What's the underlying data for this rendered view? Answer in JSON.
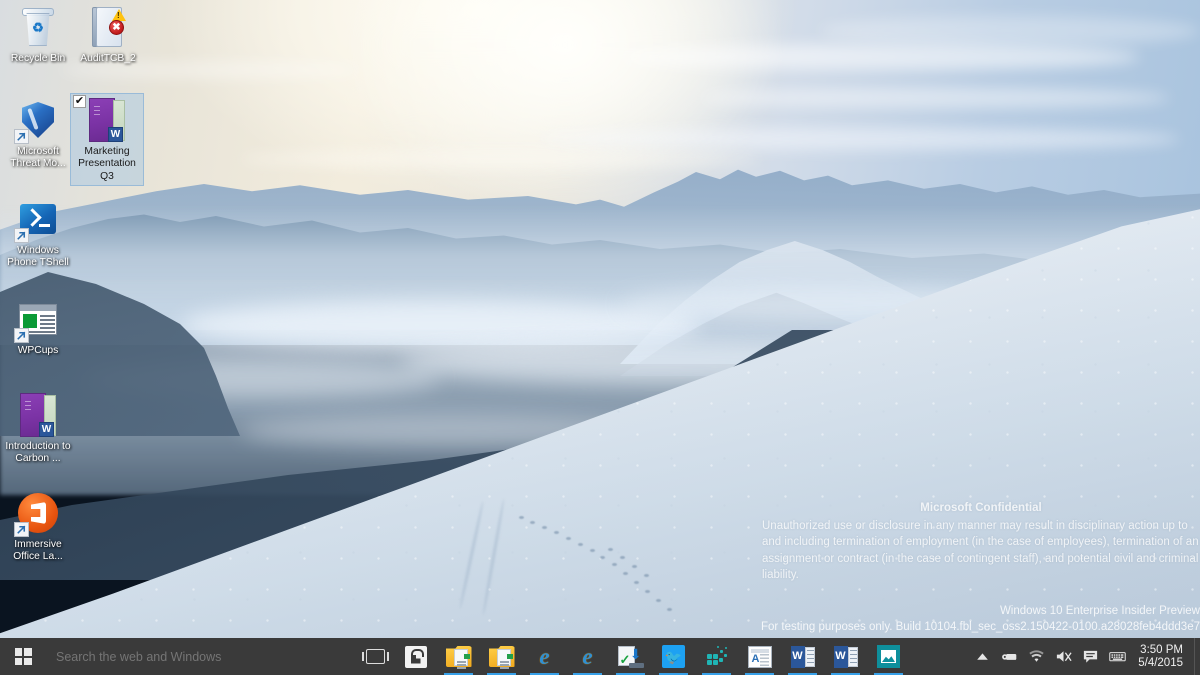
{
  "desktop": {
    "icons": [
      {
        "label": "Recycle Bin",
        "glyph": "recycle-bin-icon",
        "selected": false,
        "shortcut": false
      },
      {
        "label": "AuditTCB_2",
        "glyph": "document-error-icon",
        "selected": false,
        "shortcut": false
      },
      {
        "label": "Microsoft Threat Mo...",
        "glyph": "shield-icon",
        "selected": false,
        "shortcut": true
      },
      {
        "label": "Marketing Presentation Q3",
        "glyph": "word-document-icon",
        "selected": true,
        "shortcut": false
      },
      {
        "label": "Windows Phone TShell",
        "glyph": "powershell-icon",
        "selected": false,
        "shortcut": true
      },
      {
        "label": "WPCups",
        "glyph": "window-app-icon",
        "selected": false,
        "shortcut": true
      },
      {
        "label": "Introduction to Carbon ...",
        "glyph": "word-document-icon",
        "selected": false,
        "shortcut": false
      },
      {
        "label": "Immersive Office La...",
        "glyph": "office-orb-icon",
        "selected": false,
        "shortcut": true
      }
    ]
  },
  "watermark": {
    "confidential_title": "Microsoft Confidential",
    "confidential_body": "Unauthorized use or disclosure in any manner may result in disciplinary action up to and including termination of employment (in the case of employees), termination of an assignment or contract (in the case of contingent staff), and potential civil and criminal liability.",
    "build_line1": "Windows 10 Enterprise Insider Preview",
    "build_line2": "For testing purposes only. Build 10104.fbl_sec_oss2.150422-0100.a28028feb4ddd3e7"
  },
  "taskbar": {
    "start_label": "Start",
    "search_placeholder": "Search the web and Windows",
    "search_value": "",
    "task_view_label": "Task View",
    "pinned": [
      {
        "name": "store",
        "label": "Store",
        "running": false
      },
      {
        "name": "file-explorer",
        "label": "File Explorer",
        "running": true
      },
      {
        "name": "file-explorer-2",
        "label": "File Explorer",
        "running": true
      },
      {
        "name": "internet-explorer",
        "label": "Internet Explorer",
        "running": true
      },
      {
        "name": "internet-explorer-2",
        "label": "Internet Explorer",
        "running": true
      },
      {
        "name": "installer",
        "label": "Installer",
        "running": true
      },
      {
        "name": "twitter",
        "label": "Twitter",
        "running": true
      },
      {
        "name": "dots-app",
        "label": "App",
        "running": true
      },
      {
        "name": "picture-viewer",
        "label": "Picture Viewer",
        "running": true
      },
      {
        "name": "word",
        "label": "Word",
        "running": true
      },
      {
        "name": "word-2",
        "label": "Word",
        "running": true
      },
      {
        "name": "photos",
        "label": "Photos",
        "running": true
      }
    ],
    "tray": [
      {
        "name": "show-hidden-icons",
        "label": "Show hidden icons"
      },
      {
        "name": "removable-media",
        "label": "Safely Remove Hardware"
      },
      {
        "name": "network-wifi",
        "label": "Network"
      },
      {
        "name": "volume-muted",
        "label": "Volume muted"
      },
      {
        "name": "action-center",
        "label": "Action Center"
      },
      {
        "name": "touch-keyboard",
        "label": "Touch keyboard"
      }
    ],
    "clock": {
      "time": "3:50 PM",
      "date": "5/4/2015"
    }
  },
  "colors": {
    "taskbar_bg": "#3a3a3a",
    "accent": "#37a0e8",
    "selection": "#a0c4e2"
  }
}
